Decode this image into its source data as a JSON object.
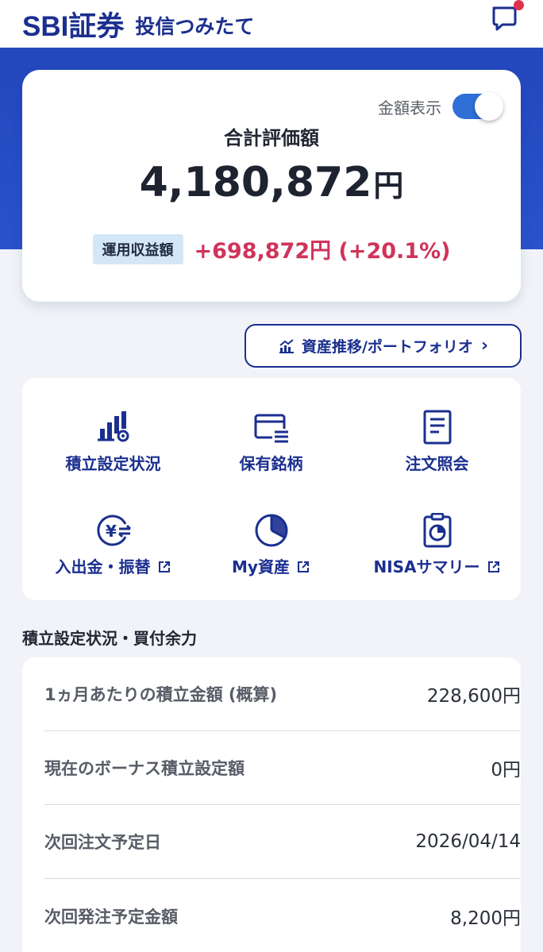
{
  "header": {
    "logo": "SBI証券",
    "title": "投信つみたて"
  },
  "summary": {
    "toggle_label": "金額表示",
    "toggle_on": true,
    "total_label": "合計評価額",
    "total_amount": "4,180,872",
    "total_unit": "円",
    "profit_badge": "運用収益額",
    "profit_value": "+698,872円 (+20.1%)"
  },
  "portfolio_button": {
    "label": "資産推移/ポートフォリオ"
  },
  "menu": {
    "items": [
      {
        "label": "積立設定状況",
        "icon": "chart-gear-icon",
        "external": false
      },
      {
        "label": "保有銘柄",
        "icon": "card-list-icon",
        "external": false
      },
      {
        "label": "注文照会",
        "icon": "document-icon",
        "external": false
      },
      {
        "label": "入出金・振替",
        "icon": "yen-transfer-icon",
        "external": true
      },
      {
        "label": "My資産",
        "icon": "pie-chart-icon",
        "external": true
      },
      {
        "label": "NISAサマリー",
        "icon": "clipboard-chart-icon",
        "external": true
      }
    ]
  },
  "reserve": {
    "section_title": "積立設定状況・買付余力",
    "rows": [
      {
        "label": "1ヵ月あたりの積立金額 (概算)",
        "value": "228,600円"
      },
      {
        "label": "現在のボーナス積立設定額",
        "value": "0円"
      },
      {
        "label": "次回注文予定日",
        "value": "2026/04/14"
      },
      {
        "label": "次回発注予定金額",
        "value": "8,200円"
      }
    ]
  },
  "colors": {
    "brand_navy": "#1b2f8f",
    "band_blue": "#2347bd",
    "profit_red": "#d0335a",
    "toggle_blue": "#2f6fd6",
    "notification_red": "#e0324d"
  }
}
